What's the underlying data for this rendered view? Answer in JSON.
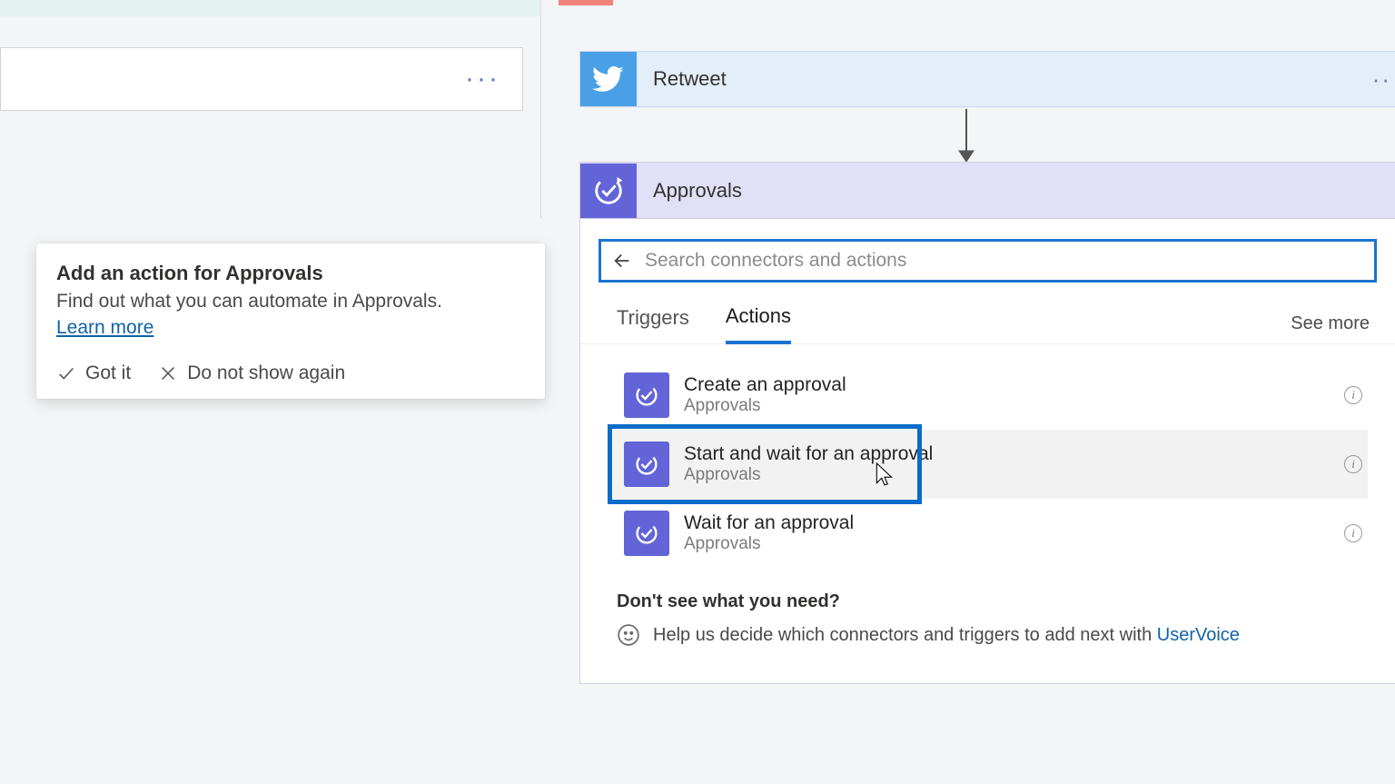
{
  "callout": {
    "title": "Add an action for Approvals",
    "body": "Find out what you can automate in Approvals.",
    "learn": "Learn more",
    "got_it": "Got it",
    "dont_show": "Do not show again"
  },
  "flow": {
    "twitter_step": "Retweet",
    "approvals_step": "Approvals"
  },
  "search": {
    "placeholder": "Search connectors and actions"
  },
  "tabs": {
    "triggers": "Triggers",
    "actions": "Actions",
    "see_more": "See more"
  },
  "actions": [
    {
      "title": "Create an approval",
      "sub": "Approvals"
    },
    {
      "title": "Start and wait for an approval",
      "sub": "Approvals"
    },
    {
      "title": "Wait for an approval",
      "sub": "Approvals"
    }
  ],
  "footer": {
    "question": "Don't see what you need?",
    "help_text": "Help us decide which connectors and triggers to add next with ",
    "link": "UserVoice"
  }
}
